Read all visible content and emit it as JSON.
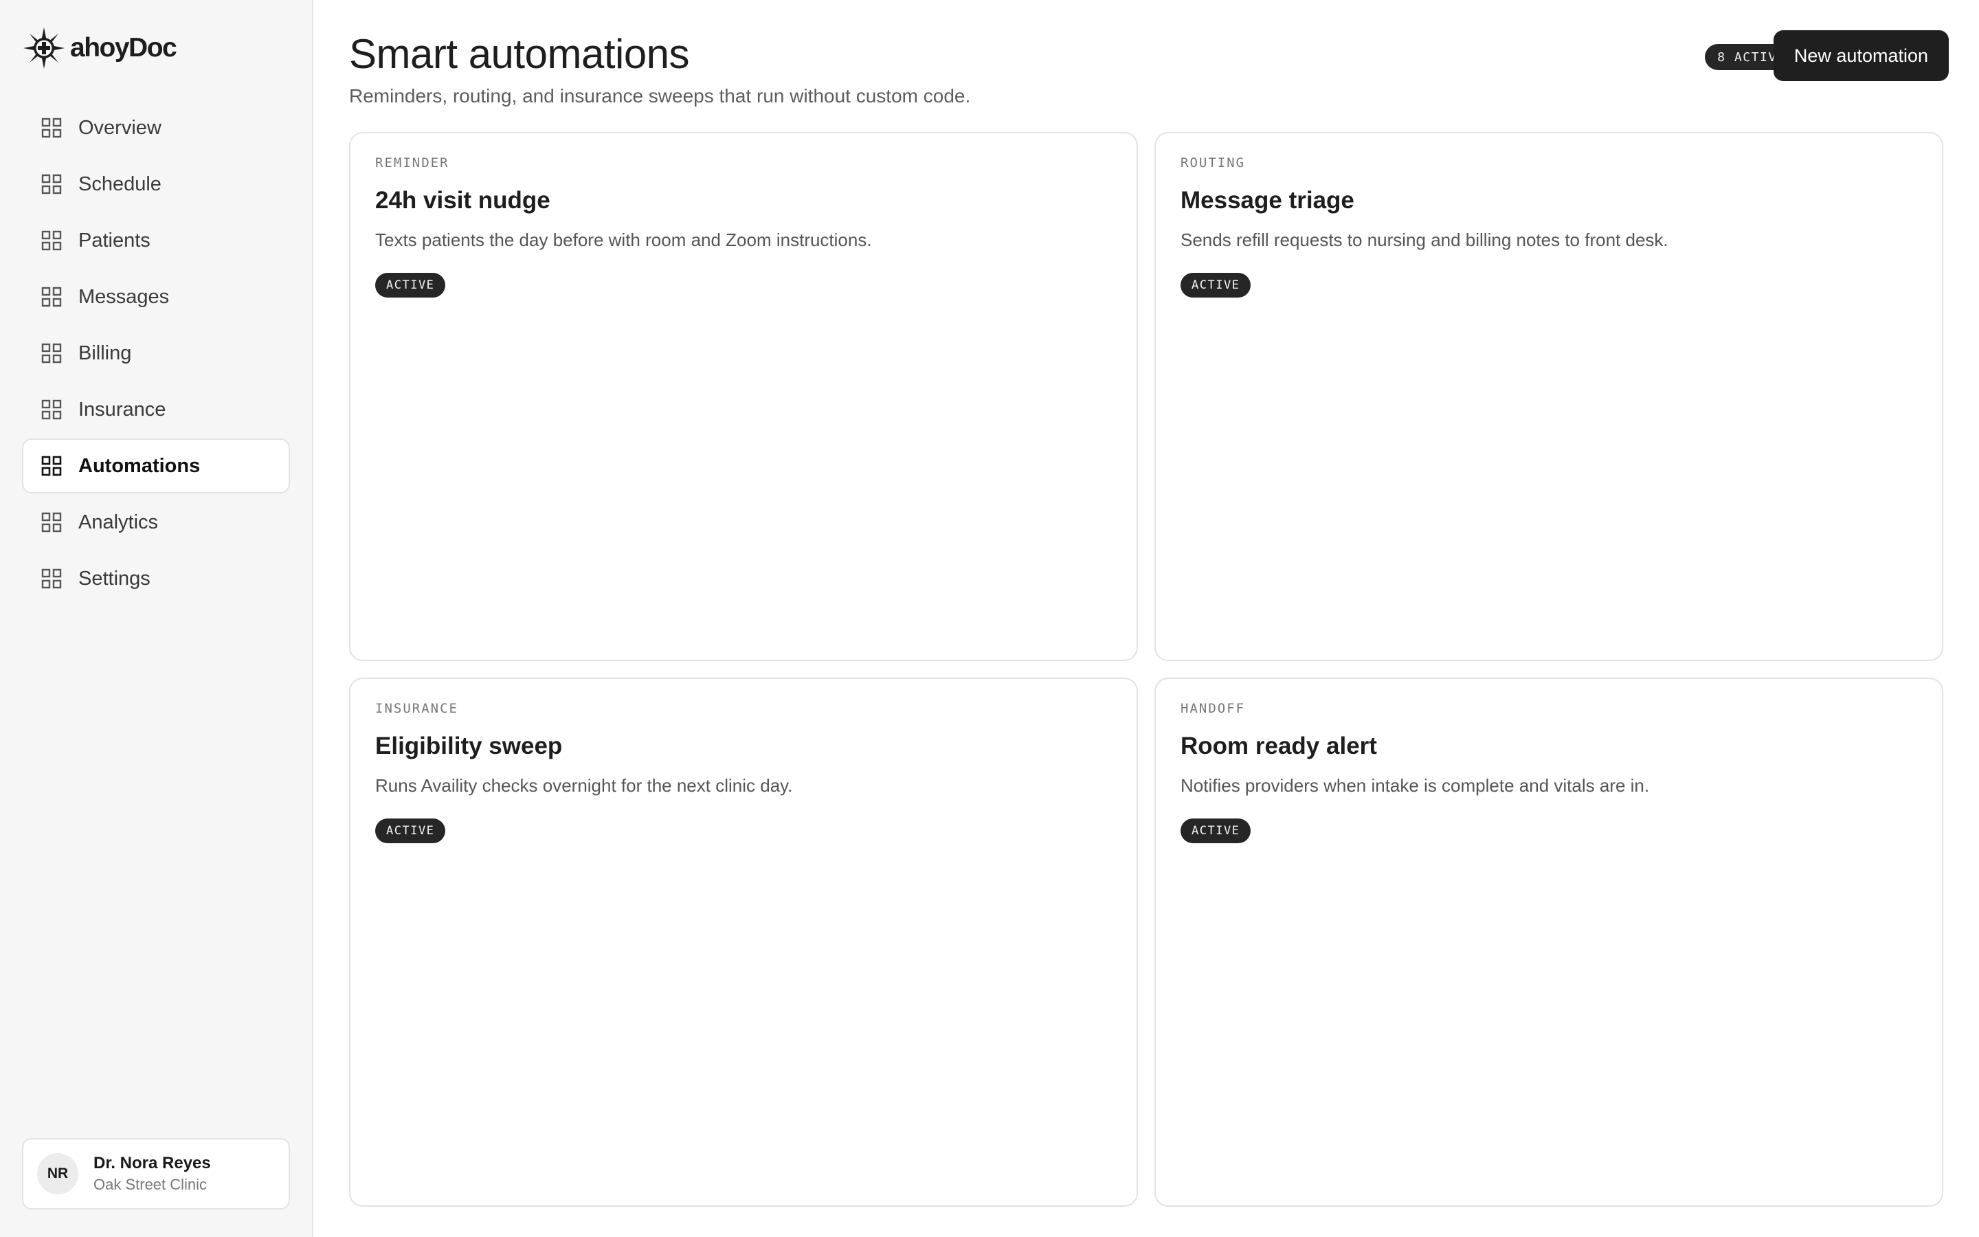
{
  "app": {
    "name": "ahoyDoc",
    "logo_icon": "compass-logo-icon"
  },
  "sidebar": {
    "items": [
      {
        "label": "Overview",
        "icon": "grid-icon",
        "active": false
      },
      {
        "label": "Schedule",
        "icon": "grid-icon",
        "active": false
      },
      {
        "label": "Patients",
        "icon": "grid-icon",
        "active": false
      },
      {
        "label": "Messages",
        "icon": "grid-icon",
        "active": false
      },
      {
        "label": "Billing",
        "icon": "grid-icon",
        "active": false
      },
      {
        "label": "Insurance",
        "icon": "grid-icon",
        "active": false
      },
      {
        "label": "Automations",
        "icon": "grid-icon",
        "active": true
      },
      {
        "label": "Analytics",
        "icon": "grid-icon",
        "active": false
      },
      {
        "label": "Settings",
        "icon": "grid-icon",
        "active": false
      }
    ],
    "user": {
      "initials": "NR",
      "name": "Dr. Nora Reyes",
      "clinic": "Oak Street Clinic"
    }
  },
  "header": {
    "title": "Smart automations",
    "subtitle": "Reminders, routing, and insurance sweeps that run without custom code.",
    "active_count_badge": "8 ACTIVE",
    "new_button_label": "New automation"
  },
  "automations": [
    {
      "kind": "REMINDER",
      "title": "24h visit nudge",
      "description": "Texts patients the day before with room and Zoom instructions.",
      "status": "ACTIVE"
    },
    {
      "kind": "ROUTING",
      "title": "Message triage",
      "description": "Sends refill requests to nursing and billing notes to front desk.",
      "status": "ACTIVE"
    },
    {
      "kind": "INSURANCE",
      "title": "Eligibility sweep",
      "description": "Runs Availity checks overnight for the next clinic day.",
      "status": "ACTIVE"
    },
    {
      "kind": "HANDOFF",
      "title": "Room ready alert",
      "description": "Notifies providers when intake is complete and vitals are in.",
      "status": "ACTIVE"
    }
  ],
  "colors": {
    "sidebar_bg": "#f6f6f6",
    "border": "#e3e3e3",
    "dark": "#1f1f1f",
    "muted_text": "#555555"
  }
}
